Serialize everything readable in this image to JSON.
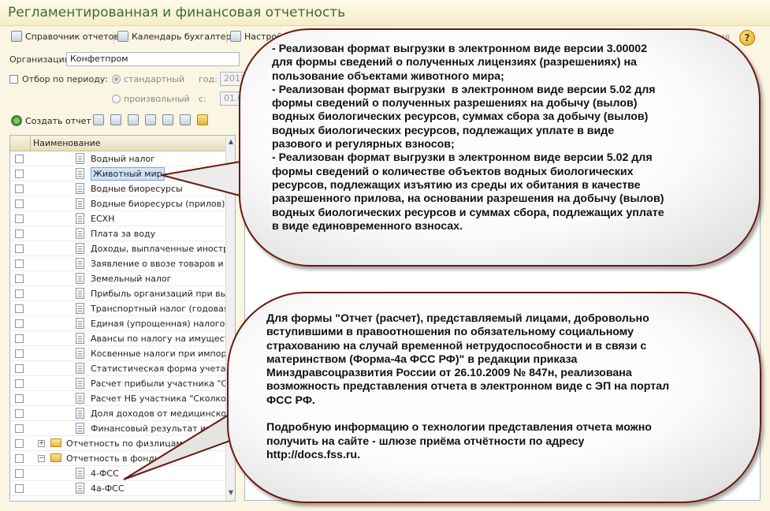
{
  "window": {
    "title": "Регламентированная и финансовая отчетность"
  },
  "toolbar": {
    "items": [
      {
        "label": "Справочник отчетов",
        "icon": "book-icon"
      },
      {
        "label": "Календарь бухгалтера",
        "icon": "calendar-icon"
      },
      {
        "label": "Настройки",
        "icon": "tools-icon"
      }
    ],
    "all_actions": "Все действия",
    "help": "?"
  },
  "filters": {
    "org_label": "Организации:",
    "org_value": "Конфетпром",
    "period_label": "Отбор по периоду:",
    "standard_label": "стандартный",
    "year_label": "год:",
    "year_value": "2013",
    "custom_label": "произвольный",
    "from_label": "с:",
    "from_value": "01.01.2013"
  },
  "actions": {
    "create_report": "Создать отчет"
  },
  "grid": {
    "header": "Наименование",
    "rows": [
      {
        "label": "Водный налог",
        "kind": "doc"
      },
      {
        "label": "Животный мир",
        "kind": "doc",
        "selected": true
      },
      {
        "label": "Водные биоресурсы",
        "kind": "doc"
      },
      {
        "label": "Водные биоресурсы (прилов)",
        "kind": "doc"
      },
      {
        "label": "ЕСХН",
        "kind": "doc"
      },
      {
        "label": "Плата за воду",
        "kind": "doc"
      },
      {
        "label": "Доходы, выплаченные иностран...",
        "kind": "doc"
      },
      {
        "label": "Заявление о ввозе товаров и упл...",
        "kind": "doc"
      },
      {
        "label": "Земельный налог",
        "kind": "doc"
      },
      {
        "label": "Прибыль организаций при выпол...",
        "kind": "doc"
      },
      {
        "label": "Транспортный налог (годовая де...",
        "kind": "doc"
      },
      {
        "label": "Единая (упрощенная) налоговая ...",
        "kind": "doc"
      },
      {
        "label": "Авансы по налогу на имущество",
        "kind": "doc"
      },
      {
        "label": "Косвенные налоги при импорте т...",
        "kind": "doc"
      },
      {
        "label": "Статистическая форма учета пер...",
        "kind": "doc"
      },
      {
        "label": "Расчет прибыли участника \"Скол...",
        "kind": "doc"
      },
      {
        "label": "Расчет НБ участника \"Сколково\"",
        "kind": "doc"
      },
      {
        "label": "Доля доходов от медицинской и ...",
        "kind": "doc"
      },
      {
        "label": "Финансовый результат инвест...",
        "kind": "doc"
      },
      {
        "label": "Отчетность по физлицам",
        "kind": "folder",
        "expander": "+"
      },
      {
        "label": "Отчетность в фонды",
        "kind": "folder",
        "expander": "−"
      },
      {
        "label": "4-ФСС",
        "kind": "doc"
      },
      {
        "label": "4а-ФСС",
        "kind": "doc"
      }
    ]
  },
  "callouts": {
    "top": "- Реализован формат выгрузки в электронном виде версии 3.00002\nдля формы сведений о полученных лицензиях (разрешениях) на\nпользование объектами животного мира;\n- Реализован формат выгрузки  в электронном виде версии 5.02 для\nформы сведений о полученных разрешениях на добычу (вылов)\nводных биологических ресурсов, суммах сбора за добычу (вылов)\nводных биологических ресурсов, подлежащих уплате в виде\nразового и регулярных взносов;\n- Реализован формат выгрузки в электронном виде версии 5.02 для\nформы сведений о количестве объектов водных биологических\nресурсов, подлежащих изъятию из среды их обитания в качестве\nразрешенного прилова, на основании разрешения на добычу (вылов)\nводных биологических ресурсов и суммах сбора, подлежащих уплате\nв виде единовременного взносах.",
    "bottom": "Для формы \"Отчет (расчет), представляемый лицами, добровольно\nвступившими в правоотношения по обязательному социальному\nстрахованию на случай временной нетрудоспособности и в связи с\nматеринством (Форма-4а ФСС РФ)\" в редакции приказа\nМинздравсоцразвития России от 26.10.2009 № 847н, реализована\nвозможность представления отчета в электронном виде с ЭП на портал\nФСС РФ.\n\nПодробную информацию о технологии представления отчета можно\nполучить на сайте - шлюзе приёма отчётности по адресу\nhttp://docs.fss.ru."
  }
}
